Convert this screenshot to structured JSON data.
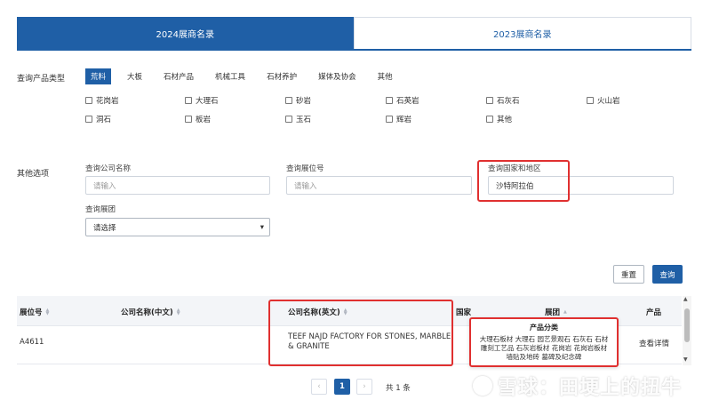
{
  "tabs": [
    {
      "label": "2024展商名录",
      "active": true
    },
    {
      "label": "2023展商名录",
      "active": false
    }
  ],
  "product_query": {
    "label": "查询产品类型",
    "categories": [
      "荒料",
      "大板",
      "石材产品",
      "机械工具",
      "石材养护",
      "媒体及协会",
      "其他"
    ],
    "active_category": "荒料",
    "options_row1": [
      "花岗岩",
      "大理石",
      "砂岩",
      "石英岩",
      "石灰石",
      "火山岩"
    ],
    "options_row2": [
      "洞石",
      "板岩",
      "玉石",
      "辉岩",
      "其他"
    ]
  },
  "other_options": {
    "label": "其他选项",
    "company_name": {
      "label": "查询公司名称",
      "placeholder": "请输入"
    },
    "booth_no": {
      "label": "查询展位号",
      "placeholder": "请输入"
    },
    "country": {
      "label": "查询国家和地区",
      "value": "沙特阿拉伯"
    },
    "group": {
      "label": "查询展团",
      "value": "请选择"
    }
  },
  "buttons": {
    "reset": "重置",
    "search": "查询"
  },
  "table": {
    "headers": [
      "展位号",
      "公司名称(中文)",
      "公司名称(英文)",
      "国家",
      "展团",
      "产品"
    ],
    "rows": [
      {
        "booth": "A4611",
        "name_cn": "",
        "name_en": "TEEF NAJD FACTORY FOR STONES, MARBLE & GRANITE",
        "action": "查看详情"
      }
    ]
  },
  "popover": {
    "title": "产品分类",
    "body": "大理石板材 大理石 园艺景观石 石灰石 石材雕刻工艺品 石灰岩板材 花岗岩 花岗岩板材 墙贴及地砖 墓碑及纪念碑"
  },
  "pagination": {
    "prev": "‹",
    "current": "1",
    "next": "›",
    "total": "共 1 条"
  },
  "watermark": "雪球：田埂上的扭牛",
  "colors": {
    "primary": "#1f5fa6",
    "highlight": "#e03030"
  }
}
